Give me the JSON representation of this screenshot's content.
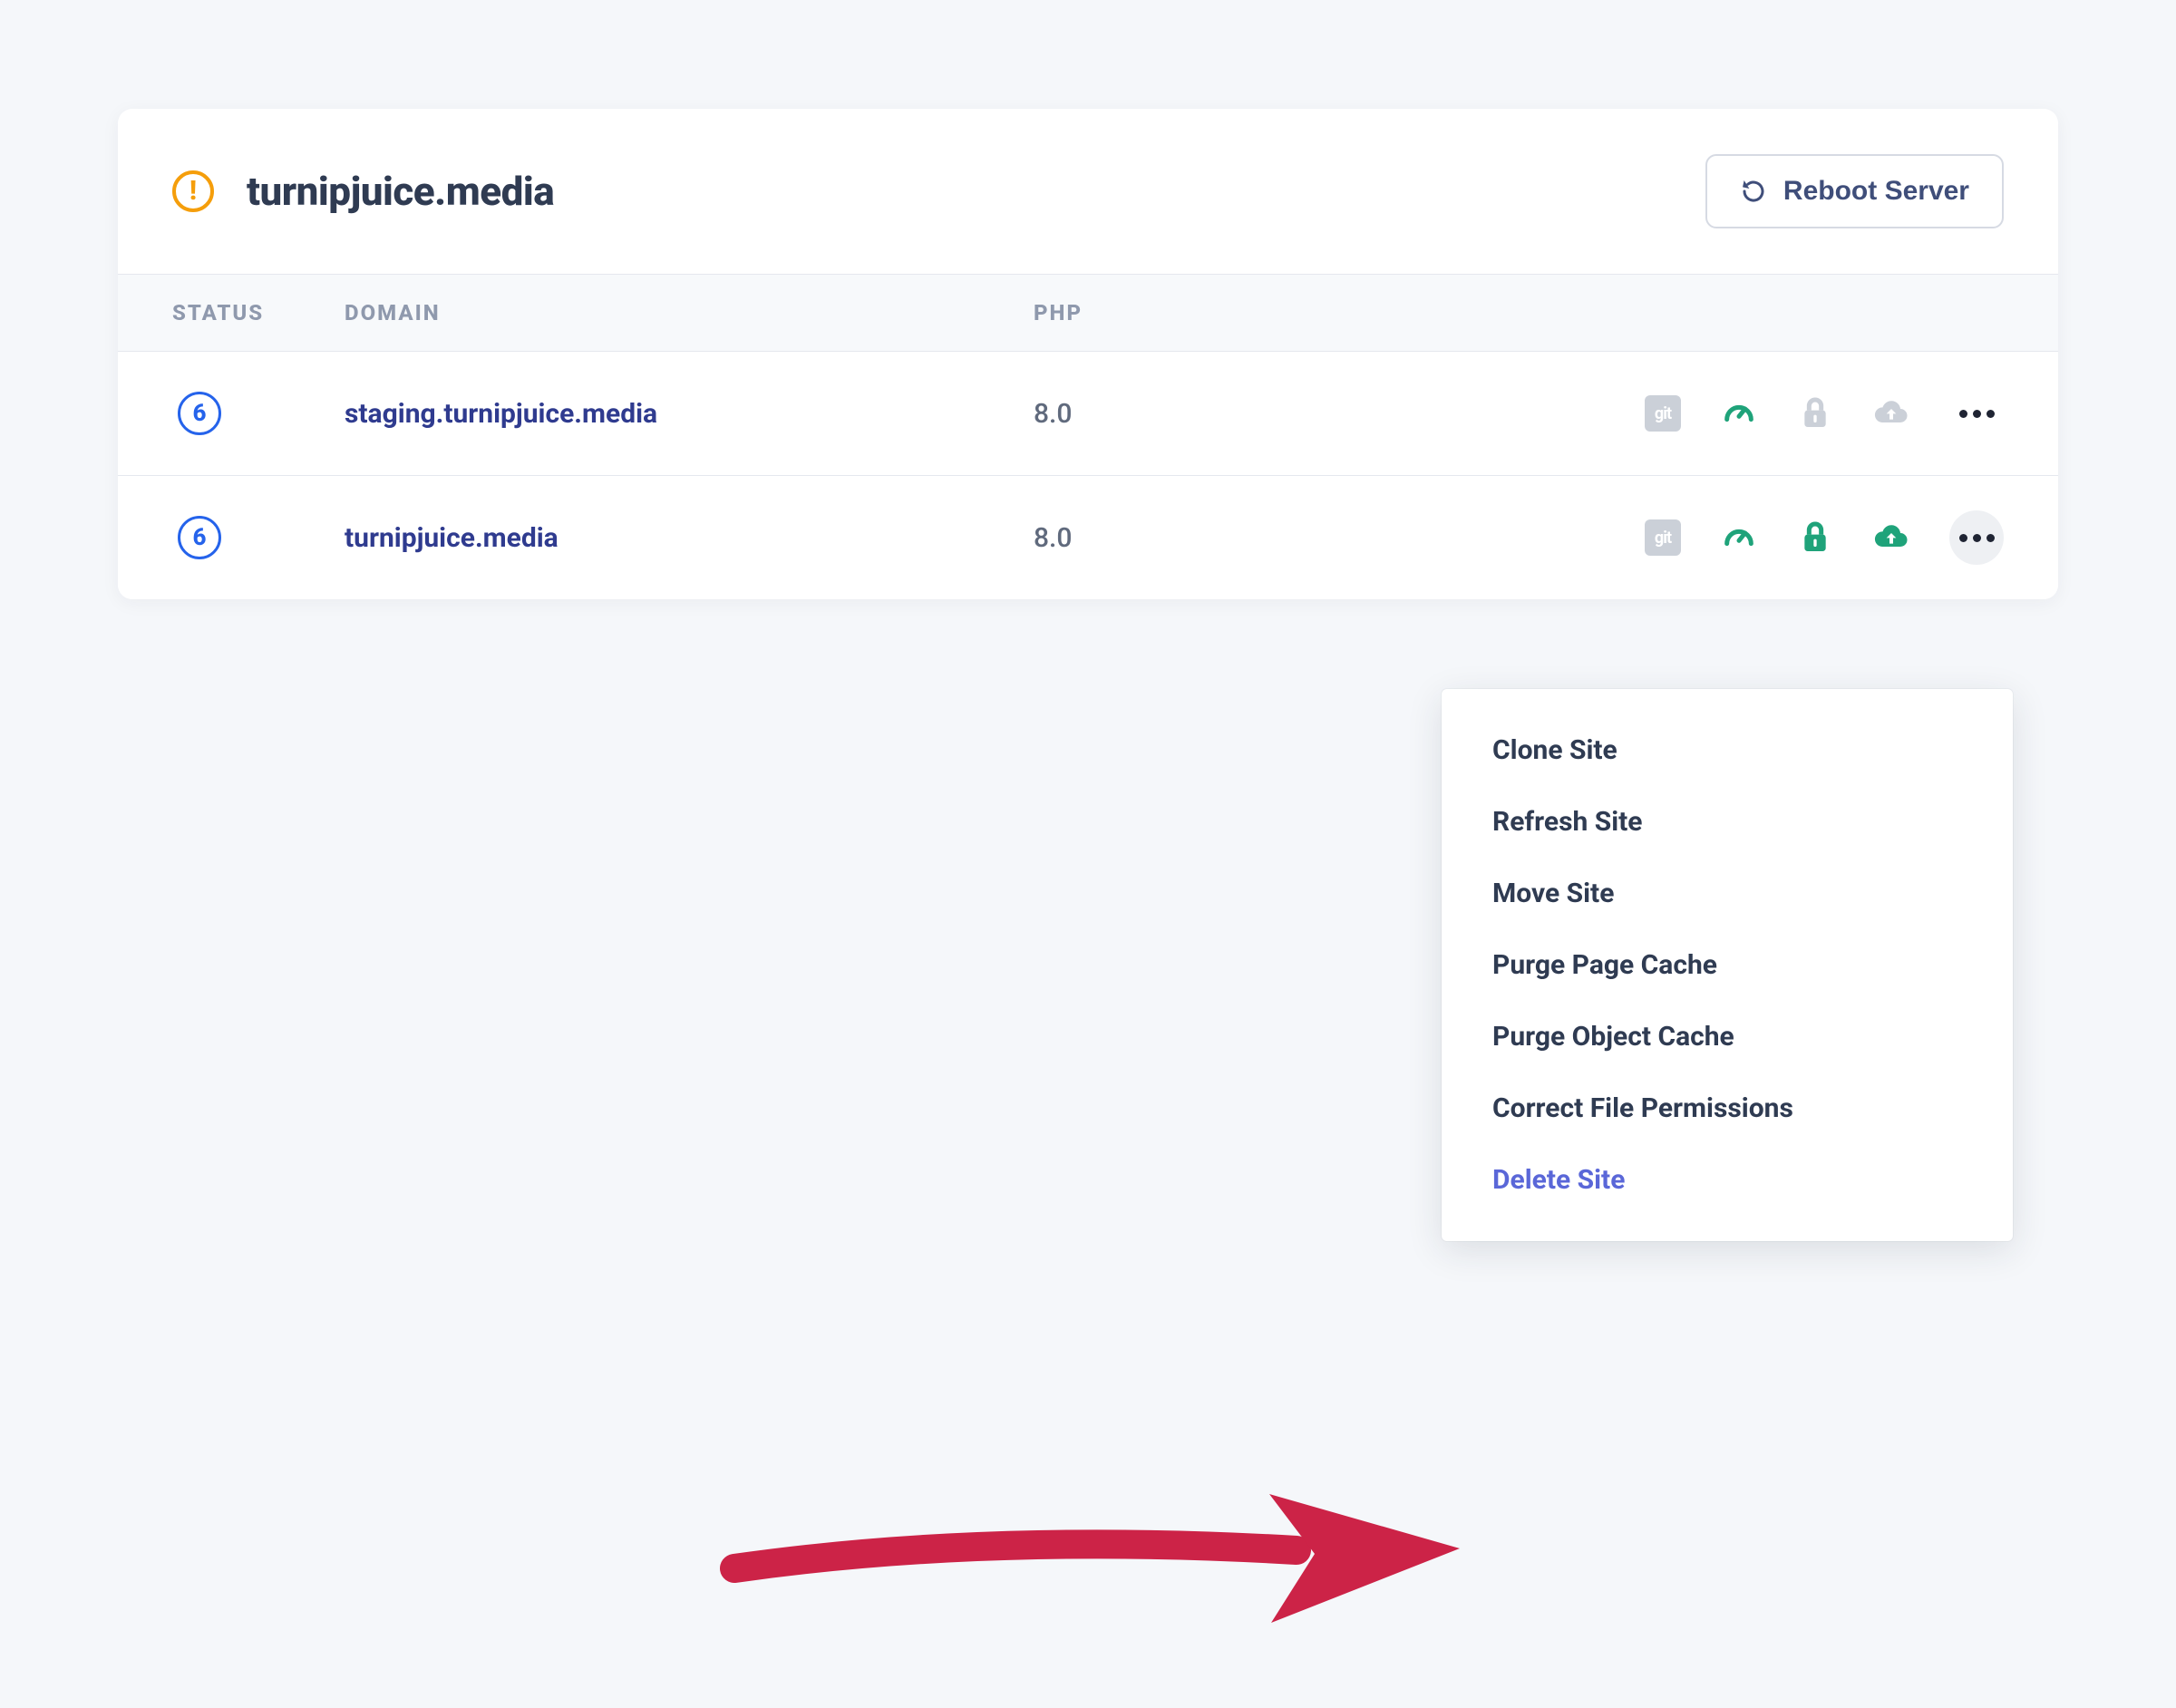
{
  "header": {
    "title": "turnipjuice.media",
    "reboot_label": "Reboot Server"
  },
  "columns": {
    "status": "STATUS",
    "domain": "DOMAIN",
    "php": "PHP"
  },
  "sites": [
    {
      "status": "6",
      "domain": "staging.turnipjuice.media",
      "php": "8.0",
      "git_active": false,
      "cache_active": true,
      "ssl_active": false,
      "backup_active": false,
      "menu_open": false
    },
    {
      "status": "6",
      "domain": "turnipjuice.media",
      "php": "8.0",
      "git_active": false,
      "cache_active": true,
      "ssl_active": true,
      "backup_active": true,
      "menu_open": true
    }
  ],
  "dropdown": {
    "items": [
      "Clone Site",
      "Refresh Site",
      "Move Site",
      "Purge Page Cache",
      "Purge Object Cache",
      "Correct File Permissions"
    ],
    "delete_label": "Delete Site"
  },
  "colors": {
    "green": "#1fa37a",
    "gray": "#cbd0d8",
    "orange": "#f59e0b",
    "blue": "#2563eb",
    "link": "#2f3b8f",
    "indigo": "#5a67d8",
    "arrow": "#cc2347"
  }
}
